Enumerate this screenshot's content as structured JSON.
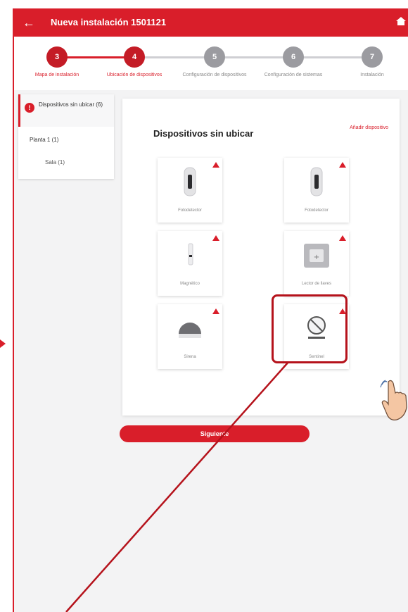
{
  "appbar": {
    "title": "Nueva instalación 1501121"
  },
  "stepper": {
    "steps": [
      {
        "number": "3",
        "label": "Mapa de instalación",
        "state": "done"
      },
      {
        "number": "4",
        "label": "Ubicación de dispositivos",
        "state": "active"
      },
      {
        "number": "5",
        "label": "Configuración de dispositivos",
        "state": "todo"
      },
      {
        "number": "6",
        "label": "Configuración de sistemas",
        "state": "todo"
      },
      {
        "number": "7",
        "label": "Instalación",
        "state": "todo"
      }
    ]
  },
  "sidebar": {
    "items": [
      {
        "label": "Dispositivos sin ubicar",
        "count": "(6)"
      },
      {
        "label": "Planta 1 (1)"
      },
      {
        "label": "Sala (1)"
      }
    ]
  },
  "panel": {
    "title": "Dispositivos sin ubicar",
    "link": "Añadir dispositivo"
  },
  "devices": [
    {
      "label": "Fotodetector",
      "icon": "camera-detector-icon"
    },
    {
      "label": "Fotodetector",
      "icon": "camera-detector-icon"
    },
    {
      "label": "Magnético",
      "icon": "magnetic-sensor-icon"
    },
    {
      "label": "Lector de llaves",
      "icon": "key-reader-icon"
    },
    {
      "label": "Sirena",
      "icon": "siren-icon"
    },
    {
      "label": "Sentinel",
      "icon": "sentinel-icon"
    }
  ],
  "actions": {
    "continue_label": "Siguiente"
  },
  "colors": {
    "accent": "#d91e2a",
    "background": "#f3f3f4"
  }
}
